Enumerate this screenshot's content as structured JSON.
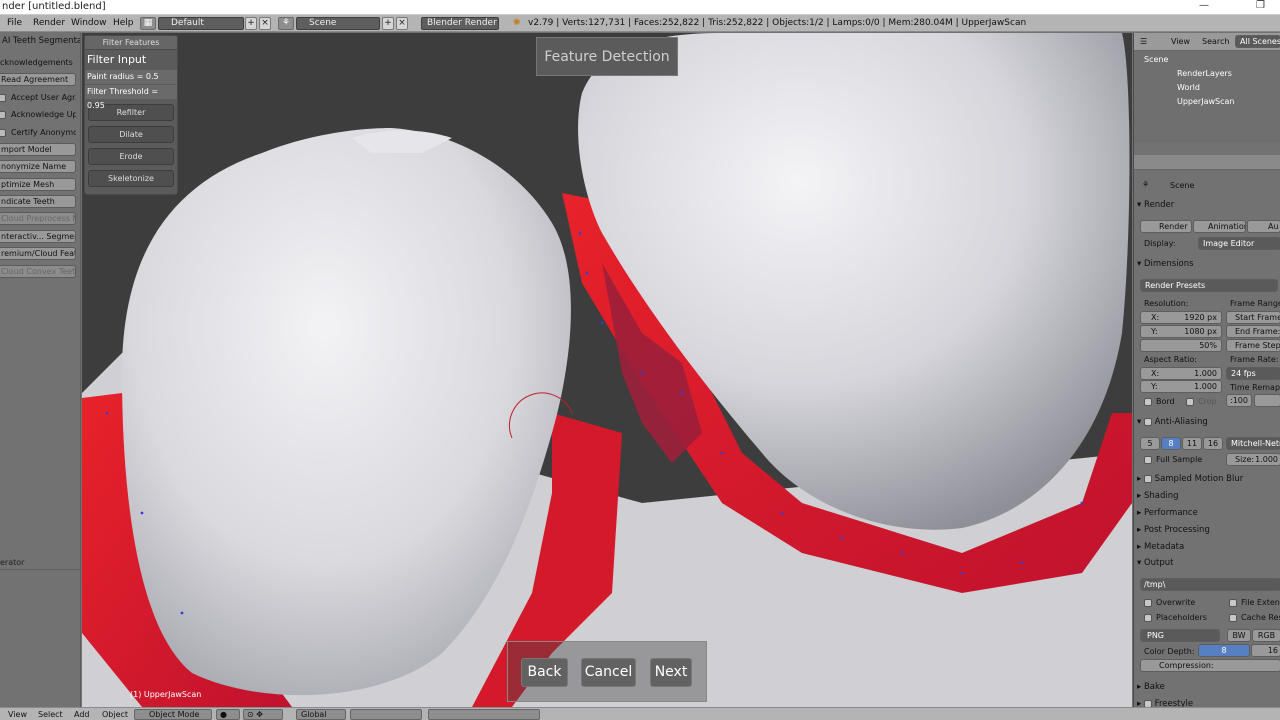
{
  "window": {
    "title": "nder [untitled.blend]",
    "minimize": "—",
    "restore": "❐"
  },
  "topbar": {
    "menus": [
      "File",
      "Render",
      "Window",
      "Help"
    ],
    "layout_field": "Default",
    "scene_field": "Scene",
    "render_engine": "Blender Render",
    "stats": "v2.79 | Verts:127,731 | Faces:252,822 | Tris:252,822 | Objects:1/2 | Lamps:0/0 | Mem:280.04M | UpperJawScan"
  },
  "left_panel": {
    "title": "AI Teeth Segmentati",
    "acknowledgements": "cknowledgements",
    "buttons": [
      {
        "label": "Read Agreement",
        "type": "button"
      },
      {
        "label": "Accept User Agr...",
        "type": "check"
      },
      {
        "label": "Acknowledge Up...",
        "type": "check"
      },
      {
        "label": "Certify Anonymous",
        "type": "check"
      },
      {
        "label": "mport Model",
        "type": "button"
      },
      {
        "label": "nonymize Name",
        "type": "button"
      },
      {
        "label": "ptimize Mesh",
        "type": "button"
      },
      {
        "label": "ndicate Teeth",
        "type": "button"
      },
      {
        "label": "Cloud Preprocess M...",
        "type": "disabled"
      },
      {
        "label": "nteractiv... Segment",
        "type": "button"
      },
      {
        "label": "remium/Cloud Featu",
        "type": "button"
      },
      {
        "label": "Cloud Convex Teeth",
        "type": "disabled"
      }
    ],
    "operator_label": "erator"
  },
  "filter_panel": {
    "header": "Filter Features",
    "title": "Filter Input",
    "paint_radius": "Paint radius  =  0.5",
    "filter_threshold": "Filter Threshold  =  0.95",
    "buttons": [
      "Refilter",
      "Dilate",
      "Erode",
      "Skeletonize"
    ]
  },
  "feature_detection": "Feature Detection",
  "wizard": {
    "back": "Back",
    "cancel": "Cancel",
    "next": "Next"
  },
  "viewport": {
    "object_label": "(1) UpperJawScan"
  },
  "right_panel": {
    "outliner": {
      "view": "View",
      "search": "Search",
      "all_scenes": "All Scenes",
      "items": [
        "Scene",
        "RenderLayers",
        "World",
        "UpperJawScan"
      ]
    },
    "properties": {
      "context": "Scene",
      "render_header": "Render",
      "render_btn": "Render",
      "animation_btn": "Animation",
      "audio_btn": "Au",
      "display_label": "Display:",
      "display_value": "Image Editor",
      "dimensions": "Dimensions",
      "render_presets": "Render Presets",
      "resolution": "Resolution:",
      "res_x": "1920 px",
      "res_y": "1080 px",
      "res_pct": "50%",
      "frame_range": "Frame Range:",
      "start_frame": "Start Frame:",
      "end_frame": "End Frame:",
      "frame_step": "Frame Step:",
      "aspect_ratio": "Aspect Ratio:",
      "aspect_x": "1.000",
      "aspect_y": "1.000",
      "frame_rate": "Frame Rate:",
      "fps": "24 fps",
      "time_remap": "Time Remappi",
      "remap_old": ":100",
      "remap_new": "",
      "x_label": "X:",
      "y_label": "Y:",
      "bord": "Bord",
      "crop": "Crop",
      "anti_aliasing": "Anti-Aliasing",
      "aa_samples": [
        "5",
        "8",
        "11",
        "16"
      ],
      "aa_filter": "Mitchell-Netra",
      "full_sample": "Full Sample",
      "size_label": "Size:",
      "size_value": "1.000",
      "sampled_motion_blur": "Sampled Motion Blur",
      "shading": "Shading",
      "performance": "Performance",
      "post_processing": "Post Processing",
      "metadata": "Metadata",
      "output": "Output",
      "output_path": "/tmp\\",
      "overwrite": "Overwrite",
      "file_extensions": "File Extens",
      "placeholders": "Placeholders",
      "cache_result": "Cache Resu",
      "format": "PNG",
      "bw": "BW",
      "rgb": "RGB",
      "color_depth": "Color Depth:",
      "depth_8": "8",
      "depth_16": "16",
      "compression": "Compression:",
      "bake": "Bake",
      "freestyle": "Freestyle"
    }
  },
  "bottombar": {
    "menus": [
      "View",
      "Select",
      "Add",
      "Object"
    ],
    "mode": "Object Mode",
    "orientation": "Global"
  }
}
